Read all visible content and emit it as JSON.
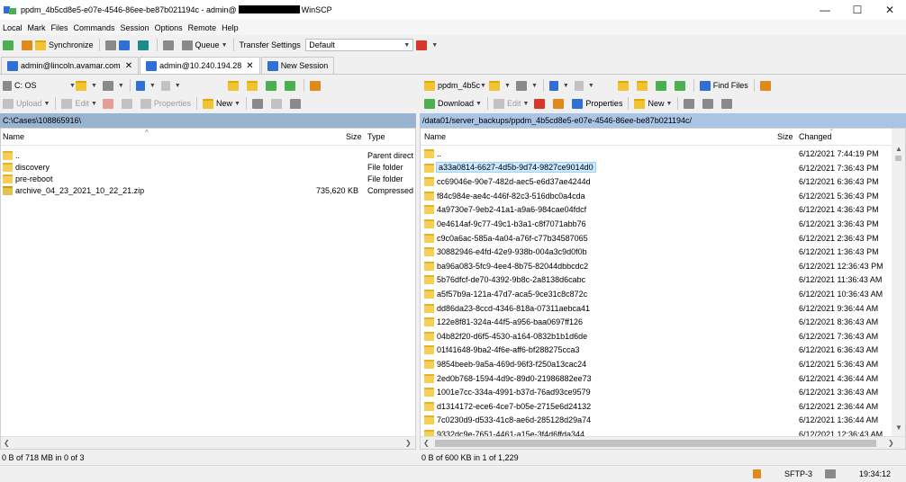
{
  "title": {
    "prefix": "ppdm_4b5cd8e5-e07e-4546-86ee-be87b021194c - admin@",
    "suffix": "WinSCP"
  },
  "window_controls": {
    "minimize": "—",
    "maximize": "☐",
    "close": "✕"
  },
  "menu": [
    "Local",
    "Mark",
    "Files",
    "Commands",
    "Session",
    "Options",
    "Remote",
    "Help"
  ],
  "toolbar": {
    "synchronize": "Synchronize",
    "queue": "Queue",
    "transfer_settings_label": "Transfer Settings",
    "transfer_settings_value": "Default"
  },
  "tabs": [
    {
      "label": "admin@lincoln.avamar.com",
      "close": "✕"
    },
    {
      "label": "admin@10.240.194.28",
      "close": "✕"
    },
    {
      "label": "New Session"
    }
  ],
  "left": {
    "drive": "C: OS",
    "upload": "Upload",
    "edit": "Edit",
    "properties": "Properties",
    "new": "New",
    "path": "C:\\Cases\\108865916\\",
    "columns": {
      "name": "Name",
      "size": "Size",
      "type": "Type"
    },
    "rows": [
      {
        "name": "..",
        "size": "",
        "type": "Parent direct",
        "icon": "parent-folder-icon"
      },
      {
        "name": "discovery",
        "size": "",
        "type": "File folder",
        "icon": "folder-icon"
      },
      {
        "name": "pre-reboot",
        "size": "",
        "type": "File folder",
        "icon": "folder-icon"
      },
      {
        "name": "archive_04_23_2021_10_22_21.zip",
        "size": "735,620 KB",
        "type": "Compressed",
        "icon": "zip-icon"
      }
    ],
    "status": "0 B of 718 MB in 0 of 3"
  },
  "right": {
    "location": "ppdm_4b5c",
    "download": "Download",
    "edit": "Edit",
    "properties": "Properties",
    "new": "New",
    "find_files": "Find Files",
    "path": "/data01/server_backups/ppdm_4b5cd8e5-e07e-4546-86ee-be87b021194c/",
    "columns": {
      "name": "Name",
      "size": "Size",
      "changed": "Changed"
    },
    "rows": [
      {
        "name": "..",
        "changed": "6/12/2021 7:44:19 PM"
      },
      {
        "name": "a33a0814-6627-4d5b-9d74-9827ce9014d0",
        "changed": "6/12/2021 7:36:43 PM"
      },
      {
        "name": "cc69046e-90e7-482d-aec5-e6d37ae4244d",
        "changed": "6/12/2021 6:36:43 PM"
      },
      {
        "name": "f84c984e-ae4c-446f-82c3-516dbc0a4cda",
        "changed": "6/12/2021 5:36:43 PM"
      },
      {
        "name": "4a9730e7-9eb2-41a1-a9a6-984cae04fdcf",
        "changed": "6/12/2021 4:36:43 PM"
      },
      {
        "name": "0e4614af-9c77-49c1-b3a1-c8f7071abb76",
        "changed": "6/12/2021 3:36:43 PM"
      },
      {
        "name": "c9c0a6ac-585a-4a04-a76f-c77b34587065",
        "changed": "6/12/2021 2:36:43 PM"
      },
      {
        "name": "30882946-e4fd-42e9-938b-004a3c9d0f0b",
        "changed": "6/12/2021 1:36:43 PM"
      },
      {
        "name": "ba96a083-5fc9-4ee4-8b75-82044dbbcdc2",
        "changed": "6/12/2021 12:36:43 PM"
      },
      {
        "name": "5b76dfcf-de70-4392-9b8c-2a8138d6cabc",
        "changed": "6/12/2021 11:36:43 AM"
      },
      {
        "name": "a5f57b9a-121a-47d7-aca5-9ce31c8c872c",
        "changed": "6/12/2021 10:36:43 AM"
      },
      {
        "name": "dd86da23-8ccd-4346-818a-07311aebca41",
        "changed": "6/12/2021 9:36:44 AM"
      },
      {
        "name": "122e8f81-324a-44f5-a956-baa0697ff126",
        "changed": "6/12/2021 8:36:43 AM"
      },
      {
        "name": "04b82f20-d6f5-4530-a164-0832b1b1d6de",
        "changed": "6/12/2021 7:36:43 AM"
      },
      {
        "name": "01f41648-9ba2-4f6e-aff6-bf288275cca3",
        "changed": "6/12/2021 6:36:43 AM"
      },
      {
        "name": "9854beeb-9a5a-469d-96f3-f250a13cac24",
        "changed": "6/12/2021 5:36:43 AM"
      },
      {
        "name": "2ed0b768-1594-4d9c-89d0-21986882ee73",
        "changed": "6/12/2021 4:36:44 AM"
      },
      {
        "name": "1001e7cc-334a-4991-b37d-76ad93ce9579",
        "changed": "6/12/2021 3:36:43 AM"
      },
      {
        "name": "d1314172-ece6-4ce7-b05e-2715e6d24132",
        "changed": "6/12/2021 2:36:44 AM"
      },
      {
        "name": "7c0230d9-d533-41c8-ae6d-285128d29a74",
        "changed": "6/12/2021 1:36:44 AM"
      },
      {
        "name": "9332dc9e-7651-4461-a15e-3f4d6ffda344",
        "changed": "6/12/2021 12:36:43 AM"
      }
    ],
    "status": "0 B of 600 KB in 1 of 1,229"
  },
  "statusbar": {
    "protocol": "SFTP-3",
    "time": "19:34:12"
  },
  "colors": {
    "path_active": "#a9c4e4",
    "path_inactive": "#99b4d1",
    "selection": "#cce8ff",
    "folder": "#f6cf56"
  }
}
